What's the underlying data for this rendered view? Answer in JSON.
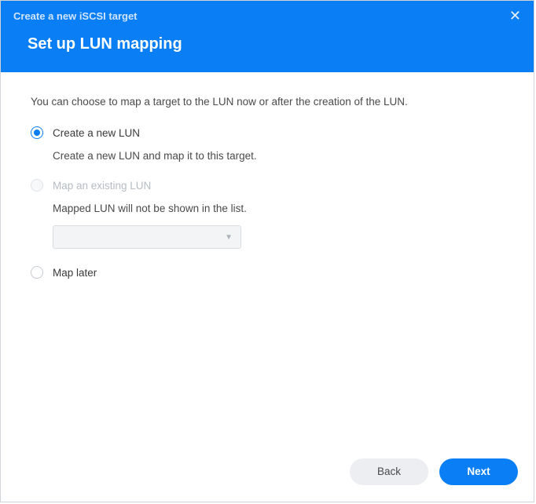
{
  "header": {
    "wizard_title": "Create a new iSCSI target",
    "step_title": "Set up LUN mapping"
  },
  "body": {
    "intro": "You can choose to map a target to the LUN now or after the creation of the LUN.",
    "options": {
      "create_new": {
        "label": "Create a new LUN",
        "desc": "Create a new LUN and map it to this target."
      },
      "map_existing": {
        "label": "Map an existing LUN",
        "desc": "Mapped LUN will not be shown in the list.",
        "dropdown_value": ""
      },
      "map_later": {
        "label": "Map later"
      }
    }
  },
  "footer": {
    "back": "Back",
    "next": "Next"
  }
}
